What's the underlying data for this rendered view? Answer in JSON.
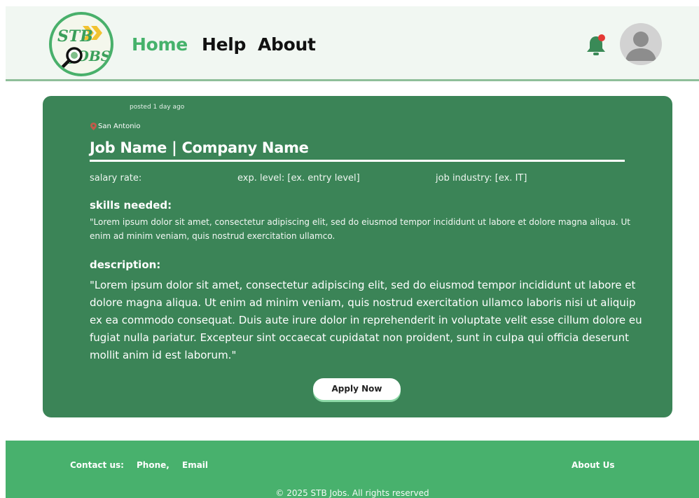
{
  "header": {
    "logo_text_top": "STB",
    "logo_text_bottom": "JOBS",
    "nav": {
      "home": "Home",
      "help": "Help",
      "about": "About"
    },
    "active_color": "#45b26b",
    "notification_badge_color": "#e53935"
  },
  "job": {
    "posted": "posted 1 day ago",
    "location": "San Antonio",
    "title": "Job Name  | Company Name",
    "salary": "salary rate:",
    "experience": "exp. level: [ex. entry level]",
    "industry": "job industry: [ex. IT]",
    "skills_heading": "skills needed:",
    "skills_text": "\"Lorem ipsum dolor sit amet, consectetur adipiscing elit, sed do eiusmod tempor incididunt ut labore et dolore magna aliqua. Ut enim ad minim veniam, quis nostrud exercitation ullamco.",
    "description_heading": "description:",
    "description_text": "\"Lorem ipsum dolor sit amet, consectetur adipiscing elit, sed do eiusmod tempor incididunt ut labore et dolore magna aliqua. Ut enim ad minim veniam, quis nostrud exercitation ullamco laboris nisi ut aliquip ex ea commodo consequat. Duis aute irure dolor in reprehenderit in voluptate velit esse cillum dolore eu fugiat nulla pariatur. Excepteur sint occaecat cupidatat non proident, sunt in culpa qui officia deserunt mollit anim id est laborum.\"",
    "apply_label": "Apply Now",
    "card_color": "#3b8457"
  },
  "footer": {
    "contact_label": "Contact us:",
    "phone": "Phone,",
    "email": "Email",
    "about": "About Us",
    "copyright": "© 2025 STB Jobs. All rights reserved",
    "color": "#48b16d"
  }
}
